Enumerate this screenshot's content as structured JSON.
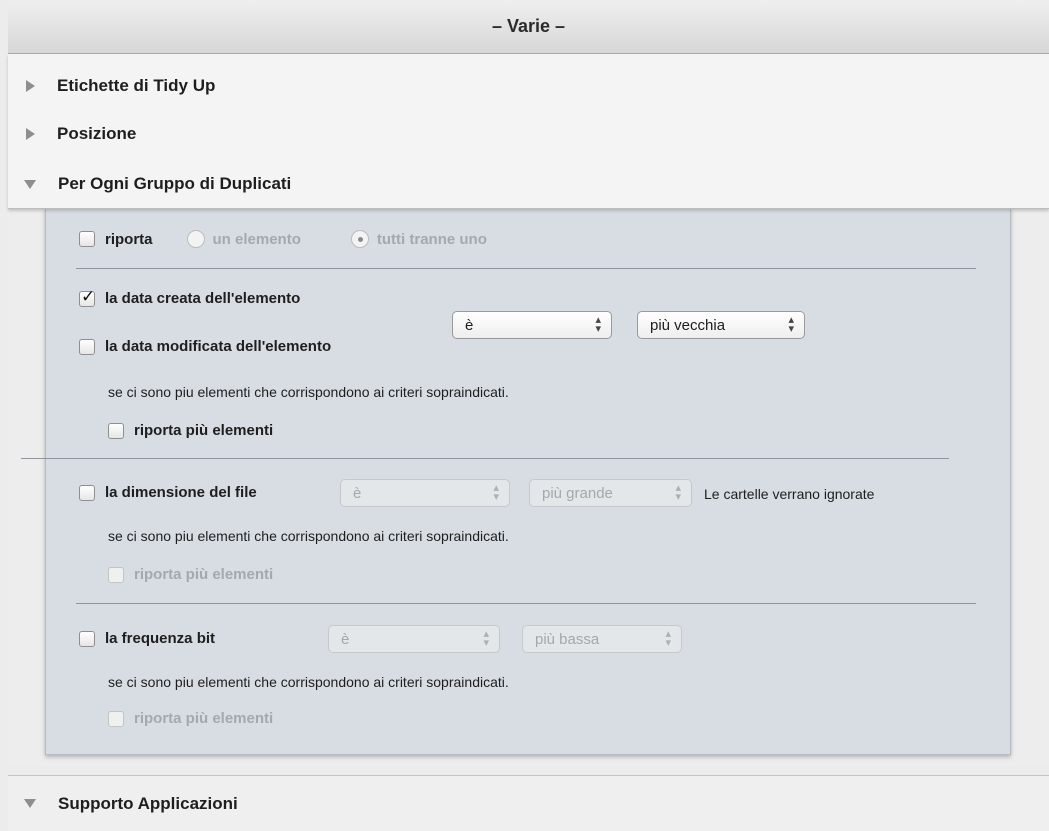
{
  "header": {
    "title": "– Varie –"
  },
  "sections": [
    {
      "label": "Etichette di Tidy Up",
      "expanded": false
    },
    {
      "label": "Posizione",
      "expanded": false
    },
    {
      "label": "Per Ogni Gruppo di Duplicati",
      "expanded": true
    }
  ],
  "duplicates": {
    "report": {
      "label": "riporta",
      "checked": false
    },
    "radio_one": {
      "label": "un elemento",
      "selected": false
    },
    "radio_all_but_one": {
      "label": "tutti tranne uno",
      "selected": true
    },
    "date_created": {
      "label": "la data creata dell'elemento",
      "checked": true
    },
    "date_modified": {
      "label": "la data modificata dell'elemento",
      "checked": false
    },
    "date_op_select": "è",
    "date_value_select": "più vecchia",
    "date_note": "se ci sono piu elementi che corrispondono ai criteri sopraindicati.",
    "date_report_more": {
      "label": "riporta più elementi",
      "checked": false
    },
    "file_size": {
      "label": "la dimensione del file",
      "checked": false
    },
    "size_op_select": "è",
    "size_value_select": "più grande",
    "size_hint": "Le cartelle verrano ignorate",
    "size_note": "se ci sono piu elementi che corrispondono ai criteri sopraindicati.",
    "size_report_more": {
      "label": "riporta più elementi",
      "checked": false
    },
    "bitrate": {
      "label": "la frequenza bit",
      "checked": false
    },
    "bitrate_op_select": "è",
    "bitrate_value_select": "più bassa",
    "bitrate_note": "se ci sono piu elementi che corrispondono ai criteri sopraindicati.",
    "bitrate_report_more": {
      "label": "riporta più elementi",
      "checked": false
    }
  },
  "footer_section": {
    "label": "Supporto Applicazioni",
    "expanded": true
  }
}
